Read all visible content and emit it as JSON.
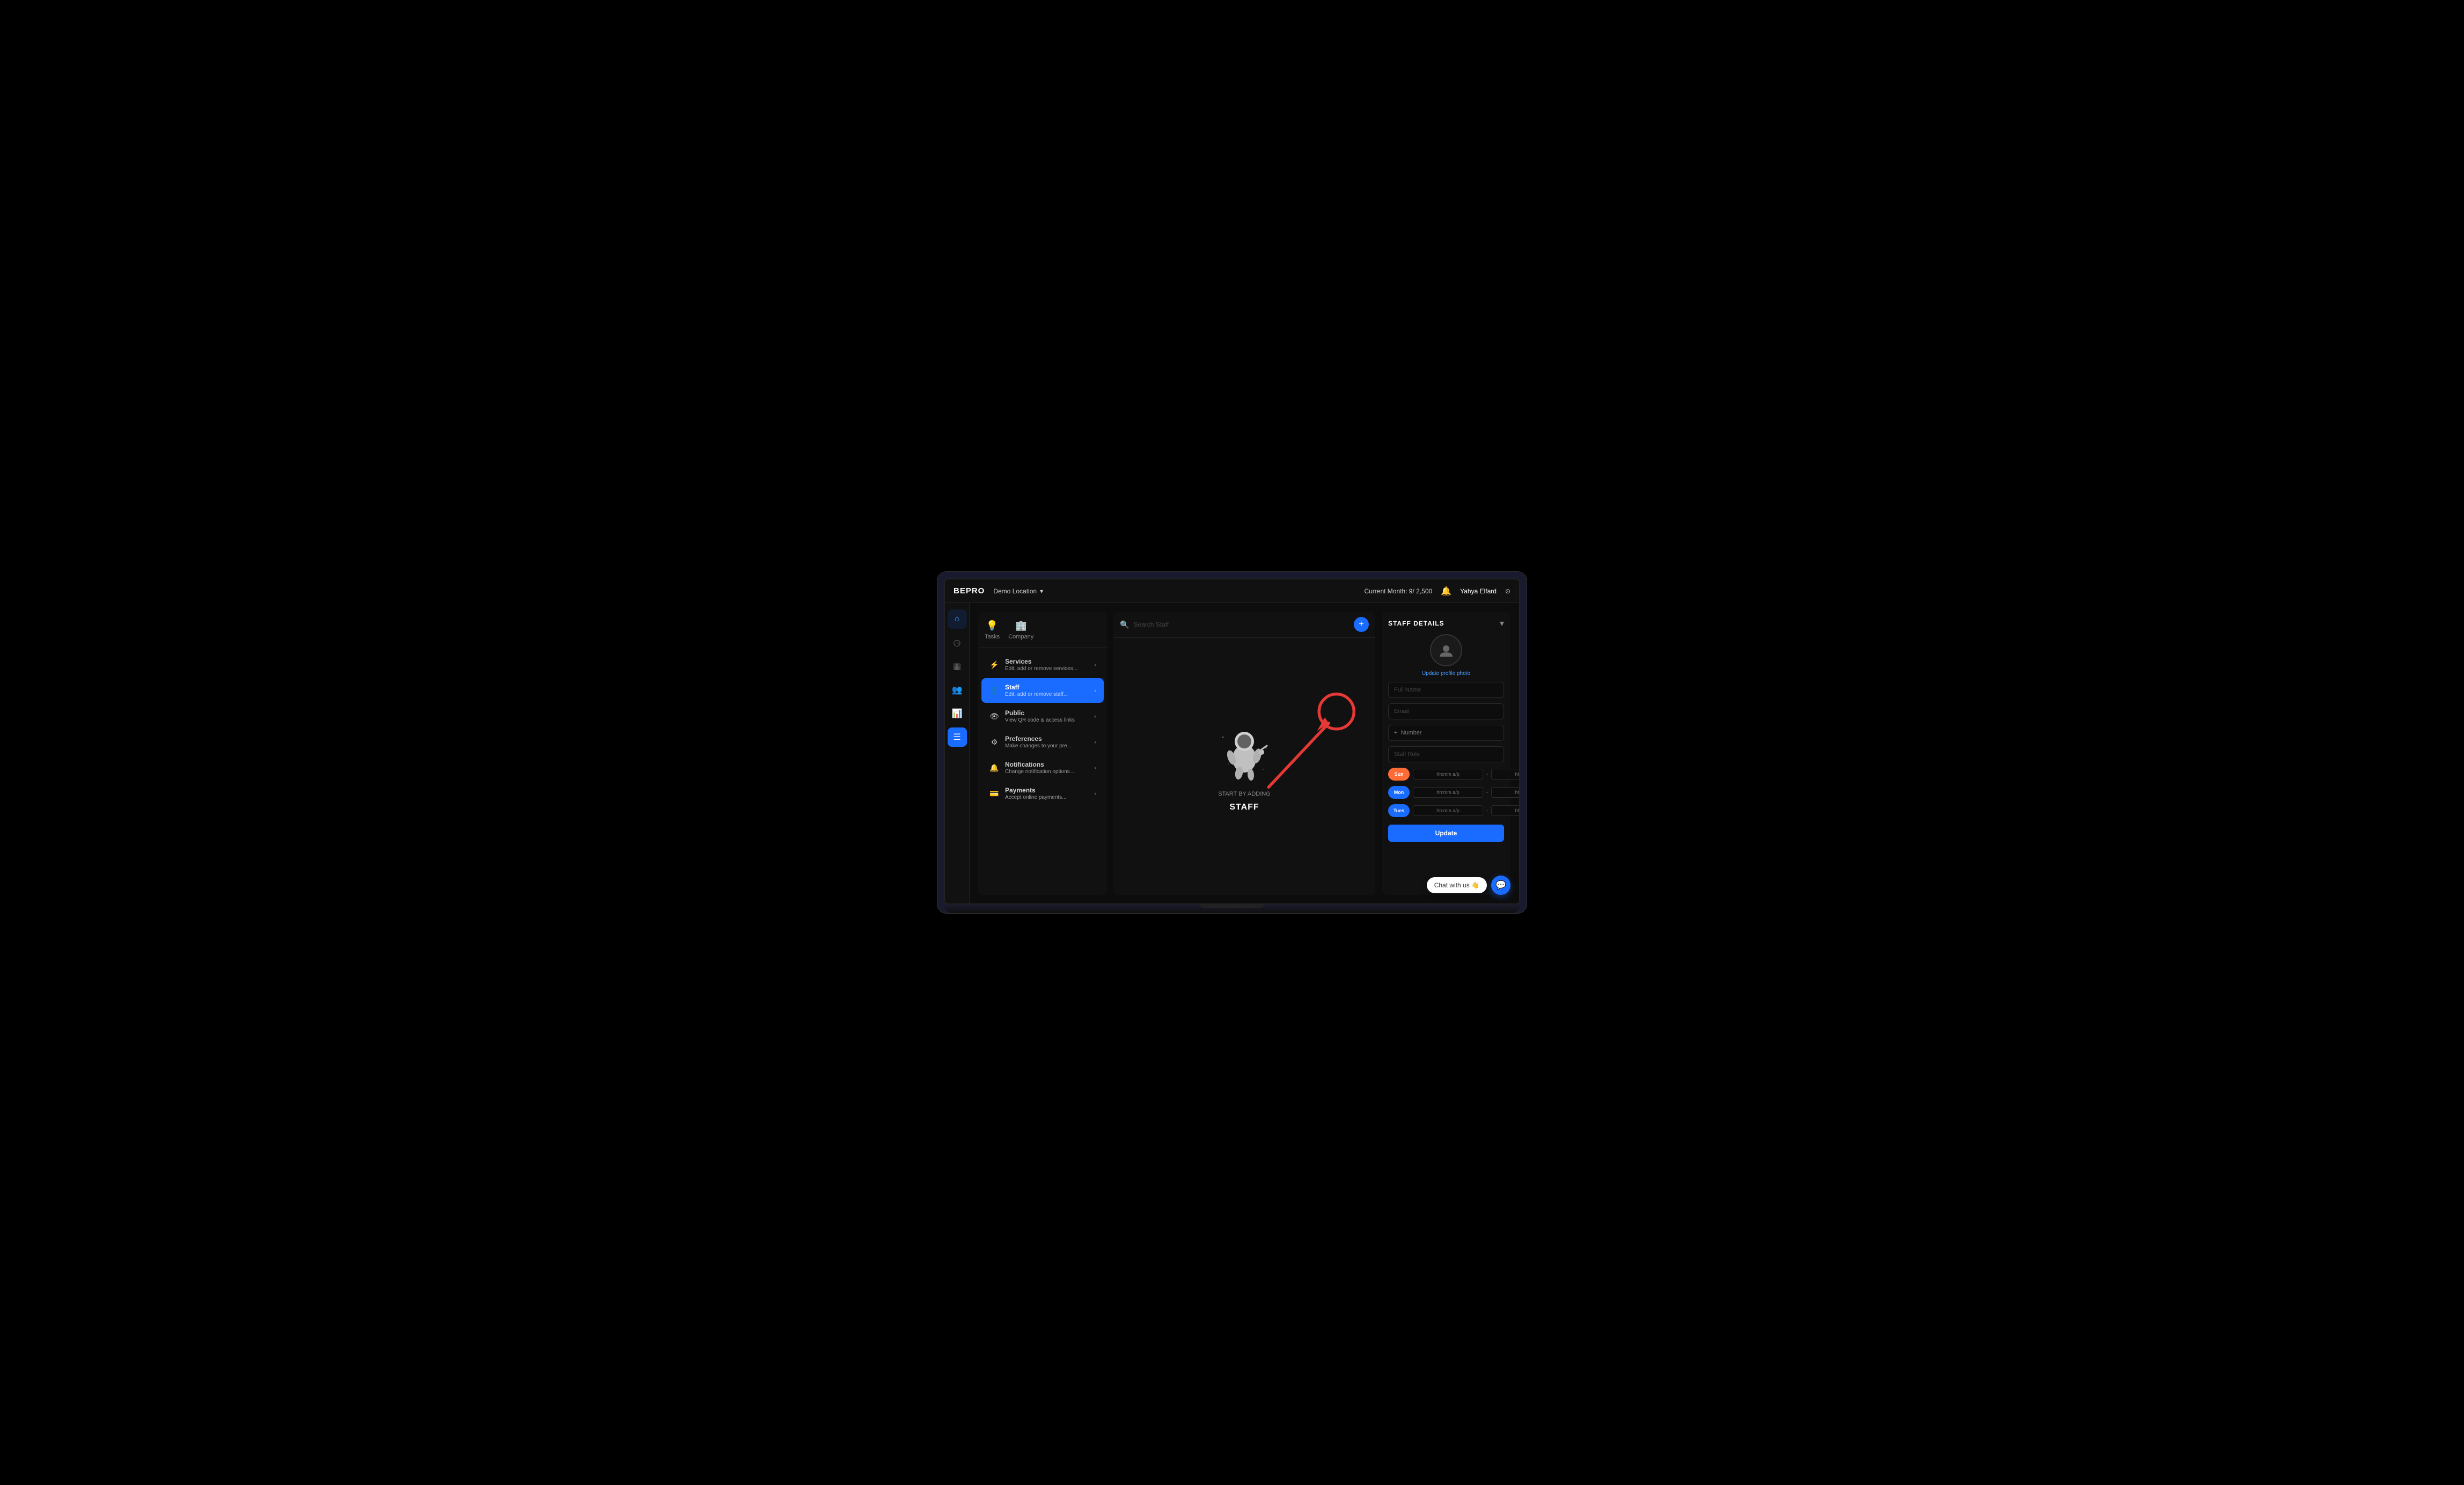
{
  "topbar": {
    "logo": "BEPRO",
    "location": "Demo Location",
    "current_month": "Current Month: 9/ 2,500",
    "user_name": "Yahya Elfard"
  },
  "sidebar": {
    "items": [
      {
        "icon": "⌂",
        "label": "Home",
        "active": false
      },
      {
        "icon": "◷",
        "label": "History",
        "active": false
      },
      {
        "icon": "▦",
        "label": "Calendar",
        "active": false
      },
      {
        "icon": "👥",
        "label": "Clients",
        "active": false
      },
      {
        "icon": "📊",
        "label": "Analytics",
        "active": false
      },
      {
        "icon": "☰",
        "label": "Settings",
        "active": true
      }
    ]
  },
  "settings_panel": {
    "tab_tasks": "Tasks",
    "tab_company": "Company",
    "menu_items": [
      {
        "id": "services",
        "icon": "⚡",
        "title": "Services",
        "sub": "Edit, add or remove services...",
        "active": false
      },
      {
        "id": "staff",
        "icon": "👤",
        "title": "Staff",
        "sub": "Edit, add or remove staff...",
        "active": true
      },
      {
        "id": "public",
        "icon": "👁",
        "title": "Public",
        "sub": "View QR code & access links",
        "active": false
      },
      {
        "id": "preferences",
        "icon": "⚙",
        "title": "Preferences",
        "sub": "Make changes to your pre...",
        "active": false
      },
      {
        "id": "notifications",
        "icon": "🔔",
        "title": "Notifications",
        "sub": "Change notification options...",
        "active": false
      },
      {
        "id": "payments",
        "icon": "💳",
        "title": "Payments",
        "sub": "Accept online payments...",
        "active": false
      }
    ]
  },
  "staff_panel": {
    "search_placeholder": "Search Staff",
    "empty_subtitle": "START BY ADDING",
    "empty_title": "STAFF"
  },
  "details_panel": {
    "title": "STAFF DETAILS",
    "update_photo_label": "Update profile photo",
    "fields": {
      "full_name_placeholder": "Full Name",
      "email_placeholder": "Email",
      "phone_prefix": "+",
      "phone_placeholder": "Number",
      "role_placeholder": "Staff Role"
    },
    "schedule": [
      {
        "day": "Sun",
        "class": "sun",
        "from_placeholder": "hh:mm a/p",
        "to_placeholder": "hh:mm a/p"
      },
      {
        "day": "Mon",
        "class": "mon",
        "from_placeholder": "hh:mm a/p",
        "to_placeholder": "hh:mm a/p"
      },
      {
        "day": "Tues",
        "class": "tue",
        "from_placeholder": "hh:mm a/p",
        "to_placeholder": "hh:mm a/p"
      }
    ],
    "update_button": "Update"
  },
  "chat_widget": {
    "label": "Chat with us 👋",
    "icon": "💬"
  }
}
